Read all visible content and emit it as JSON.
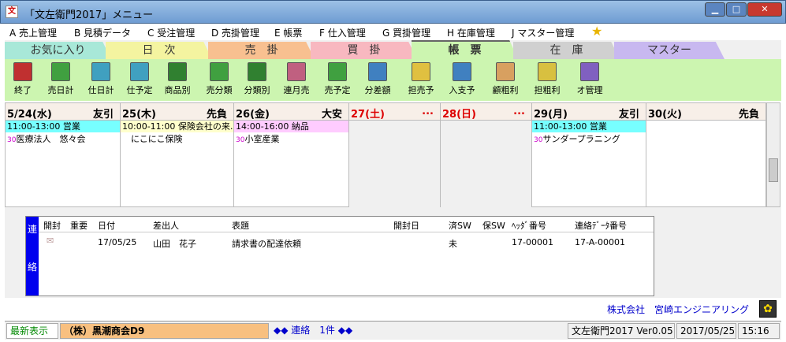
{
  "window": {
    "title": "「文左衛門2017」メニュー"
  },
  "menu": [
    "A 売上管理",
    "B 見積データ",
    "C 受注管理",
    "D 売掛管理",
    "E 帳票",
    "F 仕入管理",
    "G 買掛管理",
    "H 在庫管理",
    "J マスター管理"
  ],
  "tabs": [
    {
      "label": "お気に入り",
      "color": "#a8e8d8"
    },
    {
      "label": "日　次",
      "color": "#f4f4a0"
    },
    {
      "label": "売　掛",
      "color": "#f8c090"
    },
    {
      "label": "買　掛",
      "color": "#f8b8c0"
    },
    {
      "label": "帳　票",
      "color": "#ccf5b0"
    },
    {
      "label": "在　庫",
      "color": "#d0d0d0"
    },
    {
      "label": "マスター",
      "color": "#c8b8f0"
    }
  ],
  "toolbar": [
    {
      "label": "終了",
      "icon": "exit-door-icon",
      "color": "#c03030"
    },
    {
      "label": "売日計",
      "icon": "ledger-icon",
      "color": "#40a040"
    },
    {
      "label": "仕日計",
      "icon": "ledger-icon",
      "color": "#40a0c0"
    },
    {
      "label": "仕予定",
      "icon": "ledger-icon",
      "color": "#40a0c0"
    },
    {
      "label": "商品別",
      "icon": "ledger-icon",
      "color": "#308030"
    },
    {
      "label": "売分類",
      "icon": "ledger-icon",
      "color": "#40a040"
    },
    {
      "label": "分類別",
      "icon": "ledger-icon",
      "color": "#308030"
    },
    {
      "label": "連月売",
      "icon": "ledger-icon",
      "color": "#c06080"
    },
    {
      "label": "売予定",
      "icon": "ledger-icon",
      "color": "#40a040"
    },
    {
      "label": "分差額",
      "icon": "stack-icon",
      "color": "#4080c0"
    },
    {
      "label": "担売予",
      "icon": "ledger-icon",
      "color": "#e0c040"
    },
    {
      "label": "入支予",
      "icon": "stack-icon",
      "color": "#4080c0"
    },
    {
      "label": "顧粗利",
      "icon": "customer-icon",
      "color": "#d8a060"
    },
    {
      "label": "担粗利",
      "icon": "staff-icon",
      "color": "#d8c040"
    },
    {
      "label": "オ管理",
      "icon": "ledger-icon",
      "color": "#8060c0"
    }
  ],
  "calendar": [
    {
      "date": "5/24(水)",
      "rokuyo": "友引",
      "weekend": false,
      "event_time": "11:00-13:00 営業",
      "event_color": "#7ff",
      "tag": "30",
      "event_text": "医療法人　悠々会"
    },
    {
      "date": "25(木)",
      "rokuyo": "先負",
      "weekend": false,
      "event_time": "10:00-11:00 保険会社の来…",
      "event_color": "#ffc",
      "tag": "",
      "event_text": "　にこにこ保険"
    },
    {
      "date": "26(金)",
      "rokuyo": "大安",
      "weekend": false,
      "event_time": "14:00-16:00 納品",
      "event_color": "#fcf",
      "tag": "30",
      "event_text": "小室産業"
    },
    {
      "date": "27(土)",
      "rokuyo": "...",
      "weekend": true,
      "event_time": "",
      "event_color": "",
      "tag": "",
      "event_text": ""
    },
    {
      "date": "28(日)",
      "rokuyo": "...",
      "weekend": true,
      "event_time": "",
      "event_color": "",
      "tag": "",
      "event_text": ""
    },
    {
      "date": "29(月)",
      "rokuyo": "友引",
      "weekend": false,
      "event_time": "11:00-13:00 営業",
      "event_color": "#7ff",
      "tag": "30",
      "event_text": "サンダープラニング"
    },
    {
      "date": "30(火)",
      "rokuyo": "先負",
      "weekend": false,
      "event_time": "",
      "event_color": "",
      "tag": "",
      "event_text": ""
    }
  ],
  "renraku": {
    "side": "連\n\n絡",
    "headers": [
      "開封",
      "重要",
      "日付",
      "差出人",
      "表題",
      "開封日",
      "済SW",
      "保SW",
      "ﾍｯﾀﾞ番号",
      "連絡ﾃﾞｰﾀ番号"
    ],
    "row": {
      "date": "17/05/25",
      "sender": "山田　花子",
      "subject": "請求書の配達依頼",
      "done": "未",
      "header_no": "17-00001",
      "data_no": "17-A-00001"
    }
  },
  "company": "株式会社　宮崎エンジニアリング",
  "status": {
    "refresh": "最新表示",
    "customer": "（株）黒潮商会D9",
    "notice": "◆◆ 連絡　1件 ◆◆",
    "version": "文左衛門2017 Ver0.05",
    "date": "2017/05/25",
    "time": "15:16"
  }
}
